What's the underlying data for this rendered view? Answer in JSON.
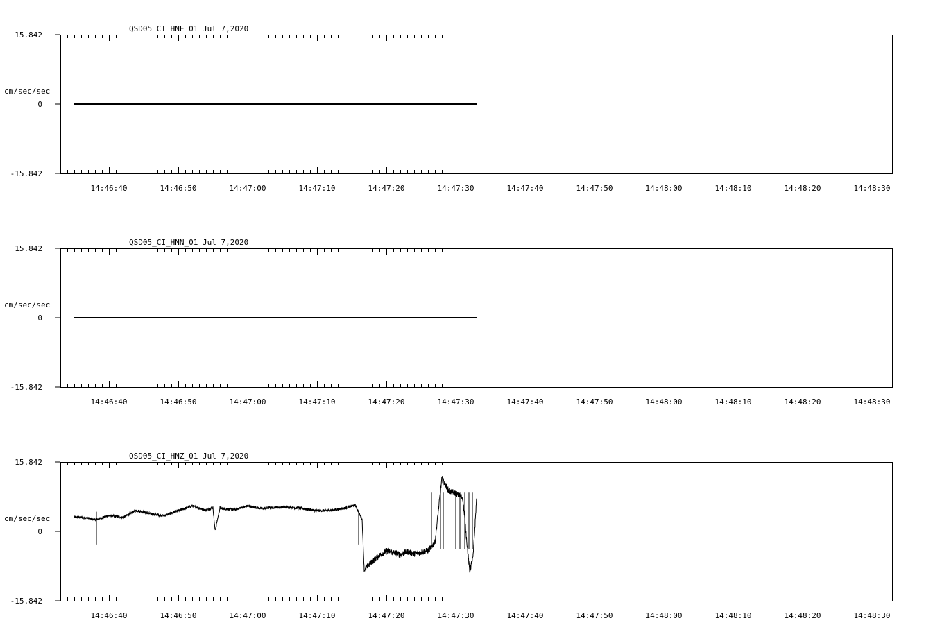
{
  "chart_data": [
    {
      "type": "line",
      "title": "QSD05_CI_HNE_01  Jul 7,2020",
      "ylabel": "cm/sec/sec",
      "ylim": [
        -15.842,
        15.842
      ],
      "ytick_labels": [
        "15.842",
        "0",
        "-15.842"
      ],
      "xtick_labels": [
        "14:46:40",
        "14:46:50",
        "14:47:00",
        "14:47:10",
        "14:47:20",
        "14:47:30",
        "14:47:40",
        "14:47:50",
        "14:48:00",
        "14:48:10",
        "14:48:20",
        "14:48:30"
      ],
      "xlim_seconds_after_14_46_40": [
        -7,
        53
      ],
      "series": [
        {
          "x": [
            -5,
            53
          ],
          "values": [
            0,
            0
          ]
        }
      ]
    },
    {
      "type": "line",
      "title": "QSD05_CI_HNN_01  Jul 7,2020",
      "ylabel": "cm/sec/sec",
      "ylim": [
        -15.842,
        15.842
      ],
      "ytick_labels": [
        "15.842",
        "0",
        "-15.842"
      ],
      "xtick_labels": [
        "14:46:40",
        "14:46:50",
        "14:47:00",
        "14:47:10",
        "14:47:20",
        "14:47:30",
        "14:47:40",
        "14:47:50",
        "14:48:00",
        "14:48:10",
        "14:48:20",
        "14:48:30"
      ],
      "xlim_seconds_after_14_46_40": [
        -7,
        53
      ],
      "series": [
        {
          "x": [
            -5,
            53
          ],
          "values": [
            0,
            0
          ]
        }
      ]
    },
    {
      "type": "line",
      "title": "QSD05_CI_HNZ_01  Jul 7,2020",
      "ylabel": "cm/sec/sec",
      "ylim": [
        -15.842,
        15.842
      ],
      "ytick_labels": [
        "15.842",
        "0",
        "-15.842"
      ],
      "xtick_labels": [
        "14:46:40",
        "14:46:50",
        "14:47:00",
        "14:47:10",
        "14:47:20",
        "14:47:30",
        "14:47:40",
        "14:47:50",
        "14:48:00",
        "14:48:10",
        "14:48:20",
        "14:48:30"
      ],
      "xlim_seconds_after_14_46_40": [
        -7,
        53
      ],
      "series": [
        {
          "x": [
            -5,
            -3,
            -2,
            0,
            2,
            4,
            6,
            8,
            10,
            12,
            14,
            15,
            15.3,
            16,
            18,
            20,
            22,
            24,
            26,
            28,
            30,
            32,
            34,
            35.5,
            36.5,
            36.8,
            37.5,
            38.5,
            40,
            42,
            43,
            44,
            46,
            47,
            48,
            49,
            50,
            51,
            52,
            52.5,
            53
          ],
          "values": [
            3.3,
            3.0,
            2.6,
            3.6,
            3.2,
            4.8,
            4.0,
            3.6,
            4.7,
            5.8,
            4.8,
            5.4,
            0.2,
            5.3,
            4.9,
            5.8,
            5.2,
            5.5,
            5.5,
            5.2,
            4.7,
            4.8,
            5.3,
            6.0,
            2.7,
            -8.9,
            -7.6,
            -6.1,
            -4.4,
            -5.3,
            -4.6,
            -5.1,
            -4.4,
            -2.5,
            12.1,
            9.2,
            8.7,
            7.7,
            -9.1,
            -5.8,
            7.5
          ]
        }
      ]
    }
  ]
}
